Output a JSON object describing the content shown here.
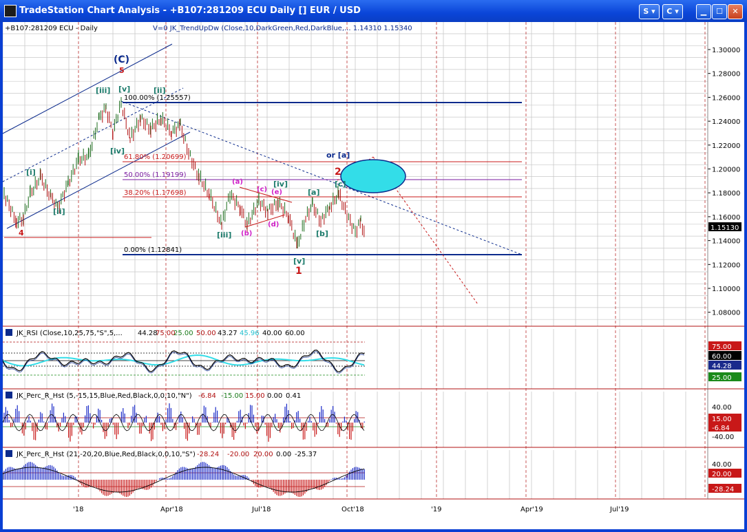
{
  "window": {
    "title": "TradeStation Chart Analysis - +B107:281209 ECU Daily [] EUR / USD",
    "buttons": [
      "S",
      "C"
    ]
  },
  "header": {
    "symbol": "+B107:281209 ECU - Daily",
    "indicator": "V=0  JK_TrendUpDw (Close,10,DarkGreen,Red,DarkBlue,...  1.14310  1.15340"
  },
  "price_axis": {
    "ticks": [
      "1.30000",
      "1.28000",
      "1.26000",
      "1.24000",
      "1.22000",
      "1.20000",
      "1.18000",
      "1.16000",
      "1.14000",
      "1.12000",
      "1.10000",
      "1.08000"
    ],
    "last": "1.15130"
  },
  "fib": {
    "f100": "100.00% (1.25557)",
    "f618": "61.80% (1.20699)",
    "f50": "50.00% (1.19199)",
    "f382": "38.20% (1.17698)",
    "f0": "0.00% (1.12841)"
  },
  "waves": {
    "C": "(C)",
    "five": "5",
    "four": "4",
    "one": "1",
    "two": "2",
    "or_a": "or [a]",
    "i": "[i]",
    "ii": "[ii]",
    "iii_top": "[iii]",
    "iv_top": "[iv]",
    "v_top": "[v]",
    "ii_top": "[ii]",
    "iii_low": "[iii]",
    "iv_mid": "[iv]",
    "v_low": "[v]",
    "a_br": "[a]",
    "b_br": "[b]",
    "c_br": "[c]",
    "a_p": "(a)",
    "b_p": "(b)",
    "c_p": "(c)",
    "d_p": "(d)",
    "e_p": "(e)"
  },
  "rsi": {
    "label": "JK_RSI (Close,10,25,75,\"S\",5,...",
    "v1": "44.28",
    "v2": "75.00",
    "v3": "25.00",
    "v4": "50.00",
    "v5": "43.27",
    "v6": "45.96",
    "v7": "40.00",
    "v8": "60.00",
    "axis_top": "75.00",
    "axis_60": "60.00",
    "axis_cur": "44.28",
    "axis_25": "25.00"
  },
  "perc1": {
    "label": "JK_Perc_R_Hst (5,-15,15,Blue,Red,Black,0,0,10,\"N\")",
    "v1": "-6.84",
    "v2": "-15.00",
    "v3": "15.00",
    "v4": "0.00",
    "v5": "0.41",
    "axis_top": "40.00",
    "axis_15": "15.00",
    "axis_cur": "-6.84",
    "axis_bot": "-40.00"
  },
  "perc2": {
    "label": "JK_Perc_R_Hst (21,-20,20,Blue,Red,Black,0,0,10,\"S\")",
    "v1": "-28.24",
    "v2": "-20.00",
    "v3": "20.00",
    "v4": "0.00",
    "v5": "-25.37",
    "axis_top": "40.00",
    "axis_20": "20.00",
    "axis_cur": "-28.24"
  },
  "time_axis": [
    "'18",
    "Apr'18",
    "Jul'18",
    "Oct'18",
    "'19",
    "Apr'19",
    "Jul'19"
  ],
  "colors": {
    "up": "#1a6b1a",
    "down": "#b01010",
    "blue": "#0b2a8c",
    "cyan": "#33dde8"
  }
}
